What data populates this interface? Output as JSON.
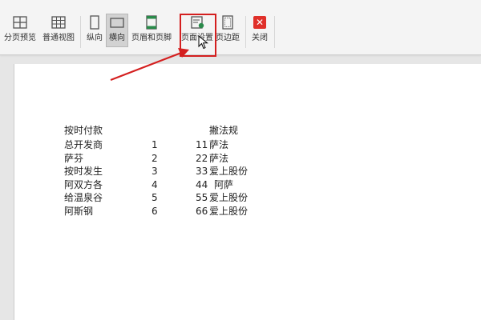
{
  "toolbar": {
    "buttons": [
      {
        "label": "分页预览",
        "icon": "page-break-preview-icon"
      },
      {
        "label": "普通视图",
        "icon": "normal-view-icon"
      },
      {
        "label": "纵向",
        "icon": "portrait-icon"
      },
      {
        "label": "横向",
        "icon": "landscape-icon"
      },
      {
        "label": "页眉和页脚",
        "icon": "header-footer-icon"
      },
      {
        "label": "页面设置",
        "icon": "page-setup-icon"
      },
      {
        "label": "页边距",
        "icon": "margins-icon"
      },
      {
        "label": "关闭",
        "icon": "close-icon"
      }
    ],
    "active": "横向",
    "highlighted": "页面设置",
    "highlight_color": "#d41f1f",
    "close_color": "#e0302a"
  },
  "sheet": {
    "header": {
      "col1": "按时付款",
      "col3": "撇法规"
    },
    "rows": [
      {
        "name": "总开发商",
        "num": "1",
        "val": "11",
        "text": "萨法"
      },
      {
        "name": "萨芬",
        "num": "2",
        "val": "22",
        "text": "萨法"
      },
      {
        "name": "按时发生",
        "num": "3",
        "val": "33",
        "text": "爱上股份"
      },
      {
        "name": "阿双方各",
        "num": "4",
        "val": "44",
        "text": "阿萨"
      },
      {
        "name": "给温泉谷",
        "num": "5",
        "val": "55",
        "text": "爱上股份"
      },
      {
        "name": "阿斯钢",
        "num": "6",
        "val": "66",
        "text": "爱上股份"
      }
    ]
  }
}
